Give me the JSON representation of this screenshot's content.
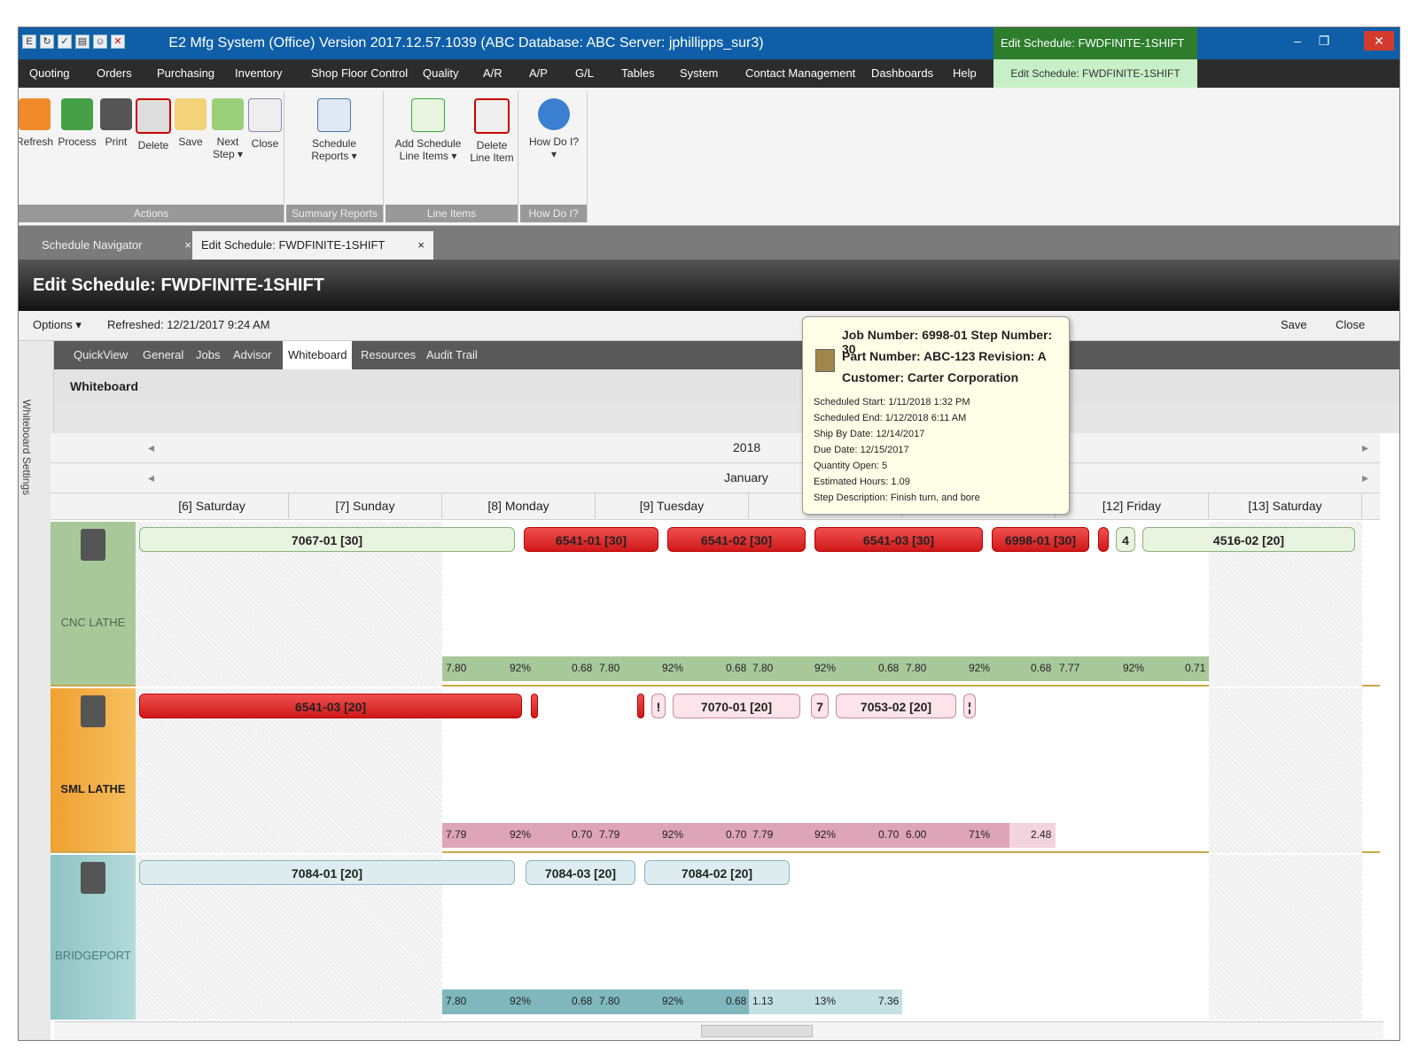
{
  "window": {
    "title": "E2 Mfg System (Office) Version 2017.12.57.1039 (ABC Database: ABC Server: jphillipps_sur3)",
    "context_title": "Edit Schedule: FWDFINITE-1SHIFT"
  },
  "window_controls": {
    "minimize": "–",
    "restore": "❐",
    "close": "✕"
  },
  "menu": [
    "Quoting",
    "Orders",
    "Purchasing",
    "Inventory",
    "Shop Floor Control",
    "Quality",
    "A/R",
    "A/P",
    "G/L",
    "Tables",
    "System",
    "Contact Management",
    "Dashboards",
    "Help"
  ],
  "menu_context_tab": "Edit Schedule: FWDFINITE-1SHIFT",
  "ribbon": {
    "actions": {
      "label": "Actions",
      "buttons": [
        "Refresh",
        "Process",
        "Print",
        "Delete",
        "Save",
        "Next Step ▾",
        "Close"
      ]
    },
    "summary": {
      "label": "Summary Reports",
      "buttons": [
        "Schedule Reports ▾"
      ]
    },
    "line_items": {
      "label": "Line Items",
      "buttons": [
        "Add Schedule Line Items ▾",
        "Delete Line Item"
      ]
    },
    "how_do_i": {
      "label": "How Do I?",
      "buttons": [
        "How Do I? ▾"
      ]
    }
  },
  "doc_tabs": {
    "navigator": "Schedule Navigator",
    "edit": "Edit Schedule: FWDFINITE-1SHIFT",
    "close": "×"
  },
  "page_title": "Edit Schedule: FWDFINITE-1SHIFT",
  "options_bar": {
    "options": "Options ▾",
    "refreshed": "Refreshed: 12/21/2017 9:24 AM",
    "save": "Save",
    "close": "Close"
  },
  "sub_tabs": [
    "QuickView",
    "General",
    "Jobs",
    "Advisor",
    "Whiteboard",
    "Resources",
    "Audit Trail"
  ],
  "active_sub_tab": "Whiteboard",
  "whiteboard_title": "Whiteboard",
  "whiteboard_settings": "Whiteboard Settings",
  "calendar": {
    "year": "2018",
    "month": "January",
    "days": [
      "[6] Saturday",
      "[7] Sunday",
      "[8] Monday",
      "[9] Tuesday",
      "",
      "",
      "[12] Friday",
      "[13] Saturday"
    ]
  },
  "resources": [
    {
      "name": "CNC LATHE",
      "color": "#a8c89a",
      "bars": [
        {
          "label": "7067-01 [30]",
          "style": "green"
        },
        {
          "label": "6541-01 [30]",
          "style": "red"
        },
        {
          "label": "6541-02 [30]",
          "style": "red"
        },
        {
          "label": "6541-03 [30]",
          "style": "red"
        },
        {
          "label": "6998-01 [30]",
          "style": "red"
        },
        {
          "label": "",
          "style": "red"
        },
        {
          "label": "4",
          "style": "green"
        },
        {
          "label": "4516-02 [20]",
          "style": "green"
        }
      ],
      "capacity": [
        [
          "7.80",
          "92%",
          "0.68"
        ],
        [
          "7.80",
          "92%",
          "0.68"
        ],
        [
          "7.80",
          "92%",
          "0.68"
        ],
        [
          "7.80",
          "92%",
          "0.68"
        ],
        [
          "7.77",
          "92%",
          "0.71"
        ]
      ]
    },
    {
      "name": "SML LATHE",
      "color": "#f4a93a",
      "bars": [
        {
          "label": "6541-03 [20]",
          "style": "red"
        },
        {
          "label": "",
          "style": "red"
        },
        {
          "label": "",
          "style": "red"
        },
        {
          "label": "!",
          "style": "pink"
        },
        {
          "label": "7070-01 [20]",
          "style": "pink"
        },
        {
          "label": "7",
          "style": "pink"
        },
        {
          "label": "7053-02 [20]",
          "style": "pink"
        },
        {
          "label": "¦",
          "style": "pink"
        }
      ],
      "capacity": [
        [
          "7.79",
          "92%",
          "0.70"
        ],
        [
          "7.79",
          "92%",
          "0.70"
        ],
        [
          "7.79",
          "92%",
          "0.70"
        ],
        [
          "6.00",
          "71%",
          "2.48"
        ]
      ]
    },
    {
      "name": "BRIDGEPORT",
      "color": "#9fcaca",
      "bars": [
        {
          "label": "7084-01 [20]",
          "style": "teal"
        },
        {
          "label": "7084-03 [20]",
          "style": "teal"
        },
        {
          "label": "7084-02 [20]",
          "style": "teal"
        }
      ],
      "capacity": [
        [
          "7.80",
          "92%",
          "0.68"
        ],
        [
          "7.80",
          "92%",
          "0.68"
        ],
        [
          "1.13",
          "13%",
          "7.36"
        ]
      ]
    }
  ],
  "tooltip": {
    "line1": "Job Number: 6998-01 Step Number: 30",
    "line2": "Part Number: ABC-123 Revision: A",
    "line3": "Customer: Carter Corporation",
    "details": [
      "Scheduled Start: 1/11/2018 1:32 PM",
      "Scheduled End: 1/12/2018 6:11 AM",
      "Ship By Date: 12/14/2017",
      "Due Date: 12/15/2017",
      "Quantity Open: 5",
      "Estimated Hours: 1.09",
      "Step Description: Finish turn, and bore"
    ]
  },
  "colors": {
    "title_bar": "#0f5fa8",
    "context": "#2d7d2d",
    "menu": "#2c2c2c"
  }
}
